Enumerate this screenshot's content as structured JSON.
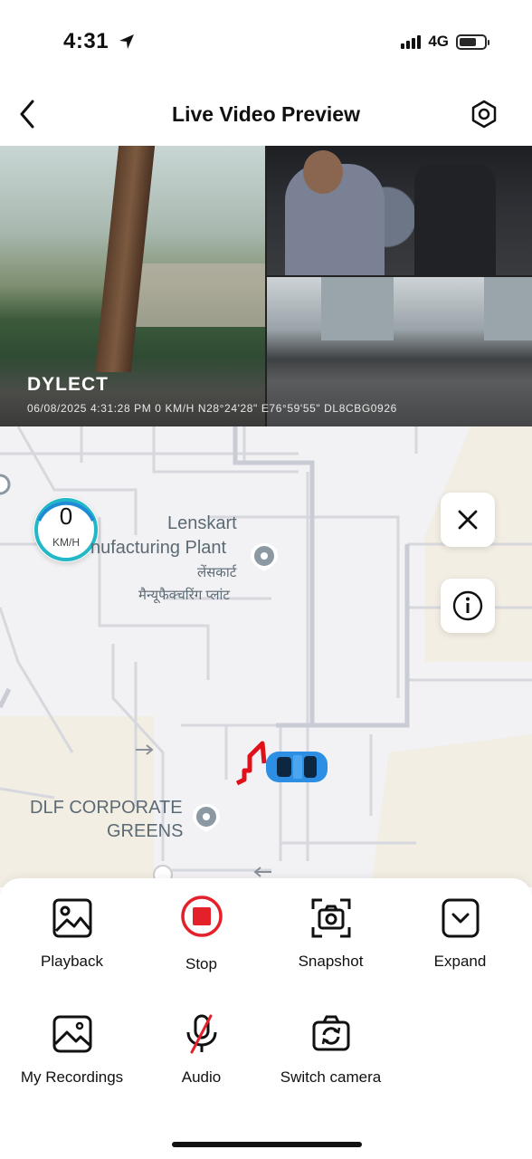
{
  "status_bar": {
    "time": "4:31",
    "network": "4G"
  },
  "nav": {
    "title": "Live Video Preview"
  },
  "video": {
    "logo": "DYLECT",
    "overlay": "06/08/2025  4:31:28 PM    0 KM/H  N28°24'28\"  E76°59'55\"   DL8CBG0926"
  },
  "map": {
    "speed": {
      "value": "0",
      "unit": "KM/H"
    },
    "pois": [
      {
        "name_en": "Lenskart",
        "name_en2": "nufacturing Plant",
        "name_hi": "लेंसकार्ट",
        "name_hi2": "मैन्यूफैक्चरिंग प्लांट"
      },
      {
        "name_en": "DLF CORPORATE",
        "name_en2": "GREENS"
      }
    ]
  },
  "actions": [
    {
      "label": "Playback",
      "icon": "image-icon"
    },
    {
      "label": "Stop",
      "icon": "stop-icon"
    },
    {
      "label": "Snapshot",
      "icon": "camera-icon"
    },
    {
      "label": "Expand",
      "icon": "chevron-down-icon"
    },
    {
      "label": "My Recordings",
      "icon": "gallery-icon"
    },
    {
      "label": "Audio",
      "icon": "mic-off-icon"
    },
    {
      "label": "Switch camera",
      "icon": "switch-camera-icon"
    }
  ],
  "colors": {
    "stop": "#e4202a",
    "speed_ring": "#1f8ad6",
    "route": "#e0101a",
    "car": "#2d8fe3"
  }
}
